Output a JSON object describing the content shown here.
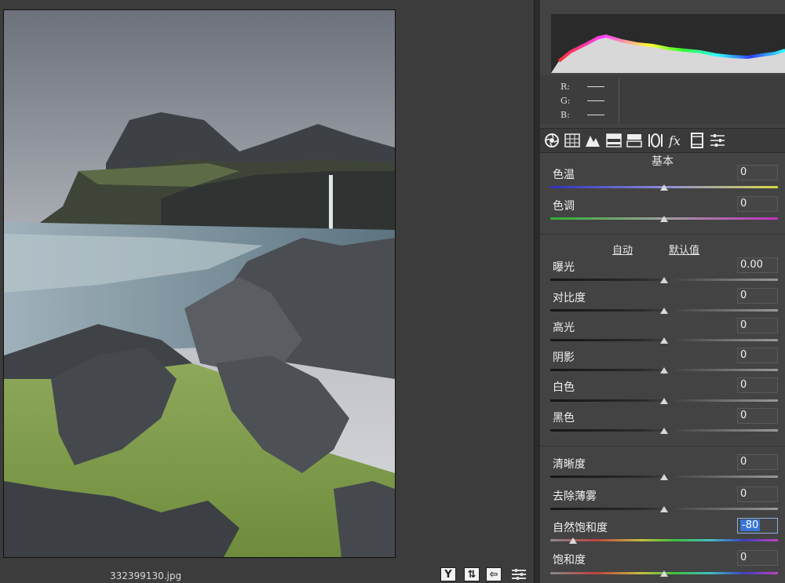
{
  "viewport": {
    "filename": "332399130.jpg",
    "buttons": [
      "Y",
      "⇅",
      "⇦"
    ]
  },
  "readout": {
    "r_label": "R:",
    "g_label": "G:",
    "b_label": "B:"
  },
  "tabs": [
    "basic-icon",
    "tone-curve-icon",
    "detail-icon",
    "hsl-icon",
    "split-tone-icon",
    "lens-icon",
    "fx-icon",
    "camera-calibration-icon",
    "presets-icon"
  ],
  "panel": {
    "section_title": "基本",
    "auto_label": "自动",
    "default_label": "默认值",
    "sliders": [
      {
        "label": "色温",
        "value": "0",
        "level": 0.5
      },
      {
        "label": "色调",
        "value": "0",
        "level": 0.5
      },
      {
        "label": "曝光",
        "value": "0.00",
        "level": 0.5
      },
      {
        "label": "对比度",
        "value": "0",
        "level": 0.5
      },
      {
        "label": "高光",
        "value": "0",
        "level": 0.5
      },
      {
        "label": "阴影",
        "value": "0",
        "level": 0.5
      },
      {
        "label": "白色",
        "value": "0",
        "level": 0.5
      },
      {
        "label": "黑色",
        "value": "0",
        "level": 0.5
      },
      {
        "label": "清晰度",
        "value": "0",
        "level": 0.5
      },
      {
        "label": "去除薄雾",
        "value": "0",
        "level": 0.5
      },
      {
        "label": "自然饱和度",
        "value": "-80",
        "level": 0.1
      },
      {
        "label": "饱和度",
        "value": "0",
        "level": 0.5
      }
    ]
  }
}
